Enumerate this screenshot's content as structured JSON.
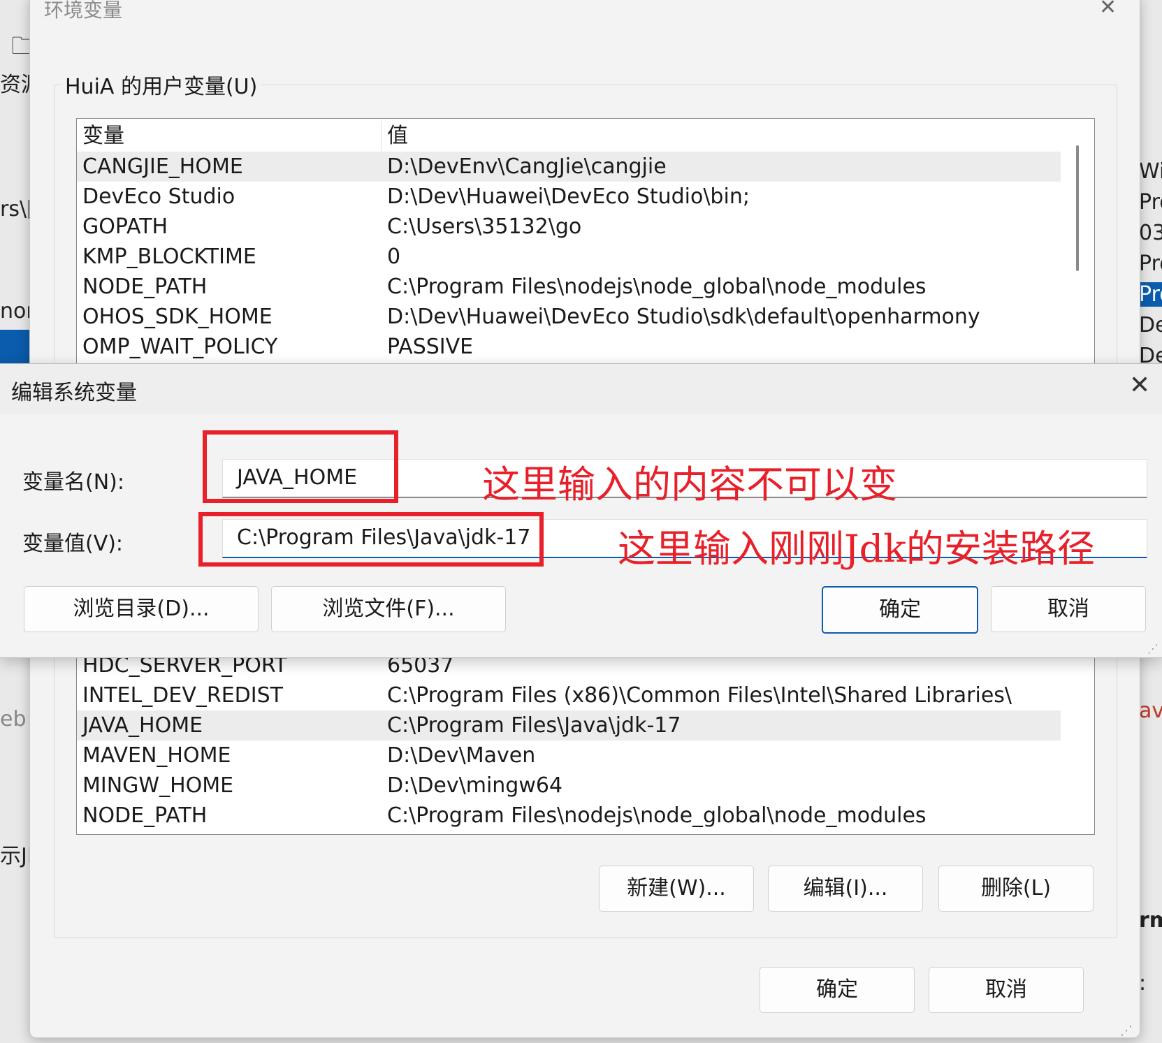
{
  "background": {
    "left_fragments": [
      "资源",
      "rs\\[",
      "non",
      "eb",
      "示JI"
    ],
    "right_fragments": [
      "Wi",
      "Pro",
      "03",
      "Pro",
      "Pro",
      "De",
      "De",
      "av",
      "rm",
      ":"
    ]
  },
  "env_window": {
    "title": "环境变量",
    "close_glyph": "✕",
    "user_group_label": "HuiA 的用户变量(U)",
    "user_table": {
      "headers": [
        "变量",
        "值"
      ],
      "rows": [
        {
          "name": "CANGJIE_HOME",
          "value": "D:\\DevEnv\\CangJie\\cangjie"
        },
        {
          "name": "DevEco Studio",
          "value": "D:\\Dev\\Huawei\\DevEco Studio\\bin;"
        },
        {
          "name": "GOPATH",
          "value": "C:\\Users\\35132\\go"
        },
        {
          "name": "KMP_BLOCKTIME",
          "value": "0"
        },
        {
          "name": "NODE_PATH",
          "value": "C:\\Program Files\\nodejs\\node_global\\node_modules"
        },
        {
          "name": "OHOS_SDK_HOME",
          "value": "D:\\Dev\\Huawei\\DevEco Studio\\sdk\\default\\openharmony"
        },
        {
          "name": "OMP_WAIT_POLICY",
          "value": "PASSIVE"
        }
      ]
    },
    "system_table": {
      "rows": [
        {
          "name": "HDC_SERVER_PORT",
          "value": "65037"
        },
        {
          "name": "INTEL_DEV_REDIST",
          "value": "C:\\Program Files (x86)\\Common Files\\Intel\\Shared Libraries\\"
        },
        {
          "name": "JAVA_HOME",
          "value": "C:\\Program Files\\Java\\jdk-17"
        },
        {
          "name": "MAVEN_HOME",
          "value": "D:\\Dev\\Maven"
        },
        {
          "name": "MINGW_HOME",
          "value": "D:\\Dev\\mingw64"
        },
        {
          "name": "NODE_PATH",
          "value": "C:\\Program Files\\nodejs\\node_global\\node_modules"
        }
      ]
    },
    "buttons": {
      "new": "新建(W)...",
      "edit": "编辑(I)...",
      "delete": "删除(L)",
      "ok": "确定",
      "cancel": "取消"
    }
  },
  "edit_dialog": {
    "title": "编辑系统变量",
    "close_glyph": "✕",
    "name_label": "变量名(N):",
    "name_value": "JAVA_HOME",
    "value_label": "变量值(V):",
    "value_value": "C:\\Program Files\\Java\\jdk-17",
    "buttons": {
      "browse_dir": "浏览目录(D)...",
      "browse_file": "浏览文件(F)...",
      "ok": "确定",
      "cancel": "取消"
    }
  },
  "annotations": {
    "name_note": "这里输入的内容不可以变",
    "value_note": "这里输入刚刚Jdk的安装路径",
    "color": "#e8202a"
  }
}
